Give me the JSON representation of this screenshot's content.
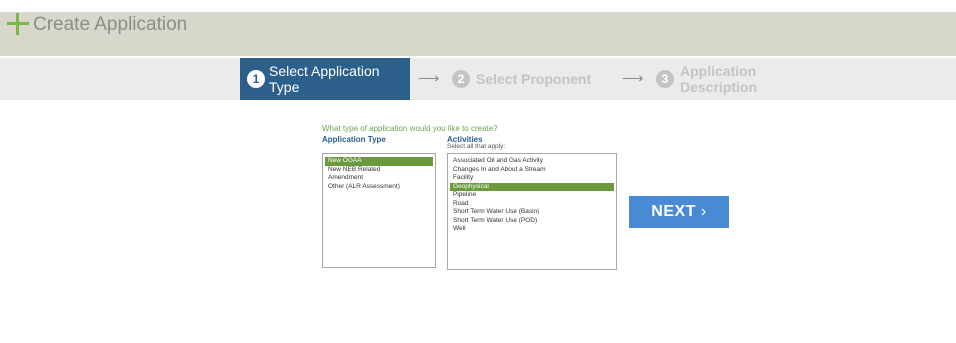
{
  "header": {
    "title": "Create Application"
  },
  "steps": [
    {
      "number": "1",
      "label": "Select Application Type"
    },
    {
      "number": "2",
      "label": "Select Proponent"
    },
    {
      "number": "3",
      "label": "Application Description"
    }
  ],
  "arrow": "⟶",
  "form": {
    "question": "What type of application would you like to create?",
    "application_type_heading": "Application Type",
    "activities_heading": "Activities",
    "activities_subtext": "Select all that apply:",
    "application_types": [
      "New OGAA",
      "New NEB Related",
      "Amendment",
      "Other (ALR Assessment)"
    ],
    "application_type_selected": "New OGAA",
    "activities": [
      "Associated Oil and Gas Activity",
      "Changes In and About a Stream",
      "Facility",
      "Geophysical",
      "Pipeline",
      "Road",
      "Short Term Water Use (Basin)",
      "Short Term Water Use (POD)",
      "Well"
    ],
    "activities_selected": "Geophysical"
  },
  "next_button": {
    "label": "NEXT",
    "chevron": "›"
  },
  "colors": {
    "accent_blue": "#2d5f8b",
    "selection_green": "#6a9a3c",
    "next_blue": "#4a8ad4",
    "plus_green": "#7ab648"
  }
}
